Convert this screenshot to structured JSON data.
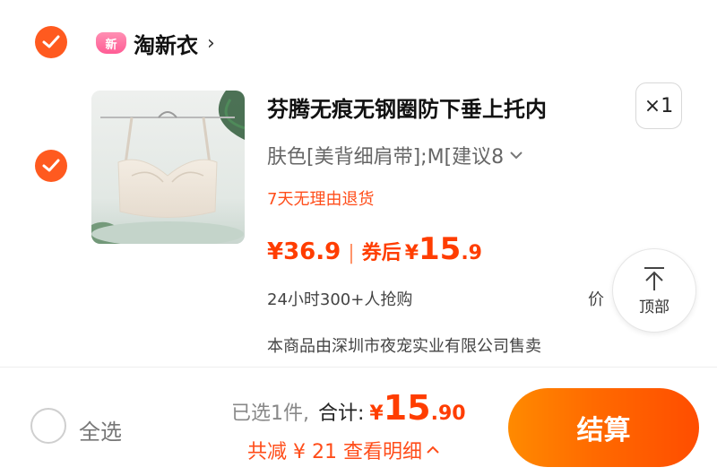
{
  "shop": {
    "logo_text": "新",
    "name": "淘新衣",
    "arrow": "›"
  },
  "item": {
    "title": "芬腾无痕无钢圈防下垂上托内",
    "quantity": "×1",
    "variant": "肤色[美背细肩带];M[建议8",
    "return_policy": "7天无理由退货",
    "price_original": "¥36.9",
    "price_separator": "|",
    "coupon_label": "券后",
    "price_currency": "¥",
    "price_int": "15",
    "price_dec": ".9",
    "sales_info": "24小时300+人抢购",
    "price_tag_partial": "价",
    "seller": "本商品由深圳市夜宠实业有限公司售卖"
  },
  "top_button": {
    "label": "顶部"
  },
  "bottom": {
    "select_all": "全选",
    "selected_count": "已选1件,",
    "total_label": "合计:",
    "total_currency": "¥",
    "total_int": "15",
    "total_dec": ".90",
    "saving_text": "共减 ¥ 21 查看明细",
    "checkout_label": "结算"
  },
  "colors": {
    "accent": "#ff5a1f",
    "price": "#ff3d00",
    "checkout_start": "#ff8a00",
    "checkout_end": "#ff4d00"
  }
}
